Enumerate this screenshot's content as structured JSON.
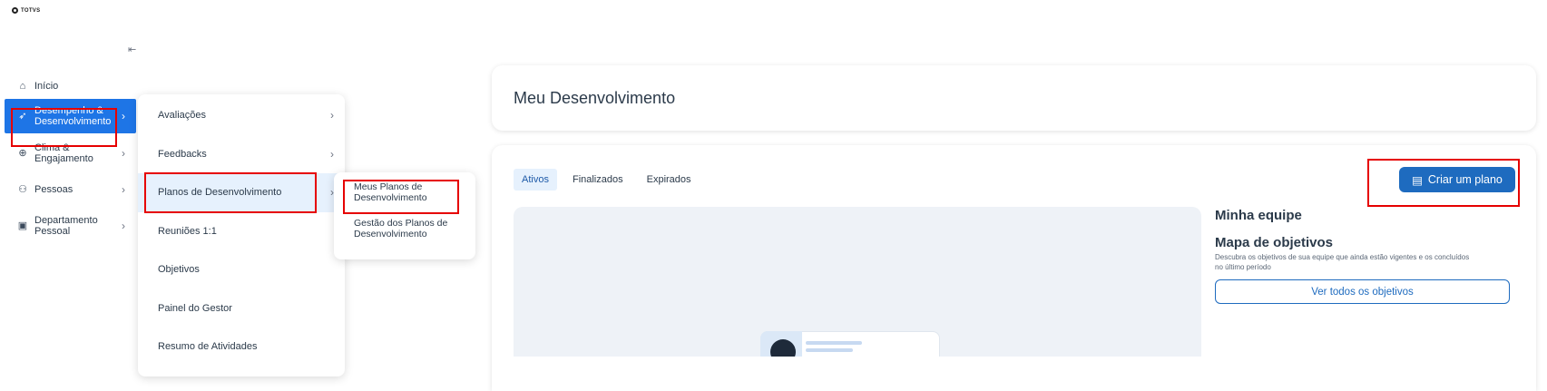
{
  "brand": {
    "logo_text": "TOTVS"
  },
  "sidebar": {
    "collapse_icon": "collapse-left-icon",
    "items": [
      {
        "label": "Início",
        "icon": "home-icon"
      },
      {
        "label": "Desempenho & Desenvolvimento",
        "label_line1": "Desempenho &",
        "label_line2": "Desenvolvimento",
        "icon": "rocket-icon"
      },
      {
        "label_line1": "Clima &",
        "label_line2": "Engajamento",
        "icon": "search-heart-icon"
      },
      {
        "label": "Pessoas",
        "icon": "people-icon"
      },
      {
        "label_line1": "Departamento",
        "label_line2": "Pessoal",
        "icon": "badge-icon"
      }
    ]
  },
  "submenu1": {
    "items": [
      {
        "label": "Avaliações"
      },
      {
        "label": "Feedbacks"
      },
      {
        "label": "Planos de Desenvolvimento"
      },
      {
        "label": "Reuniões 1:1"
      },
      {
        "label": "Objetivos"
      },
      {
        "label": "Painel do Gestor"
      },
      {
        "label": "Resumo de Atividades"
      }
    ]
  },
  "submenu2": {
    "items": [
      {
        "line1": "Meus Planos de",
        "line2": "Desenvolvimento"
      },
      {
        "line1": "Gestão dos Planos de",
        "line2": "Desenvolvimento"
      }
    ]
  },
  "main": {
    "title": "Meu Desenvolvimento",
    "tabs": [
      "Ativos",
      "Finalizados",
      "Expirados"
    ],
    "create_button": "Criar um plano",
    "team": {
      "title": "Minha equipe",
      "map_title": "Mapa de objetivos",
      "map_desc": "Descubra os objetivos de sua equipe que ainda estão vigentes e os concluídos no último período",
      "view_all": "Ver todos os objetivos"
    }
  },
  "colors": {
    "accent": "#1e75e6",
    "button": "#1e6bbf",
    "highlight": "#e60000"
  }
}
